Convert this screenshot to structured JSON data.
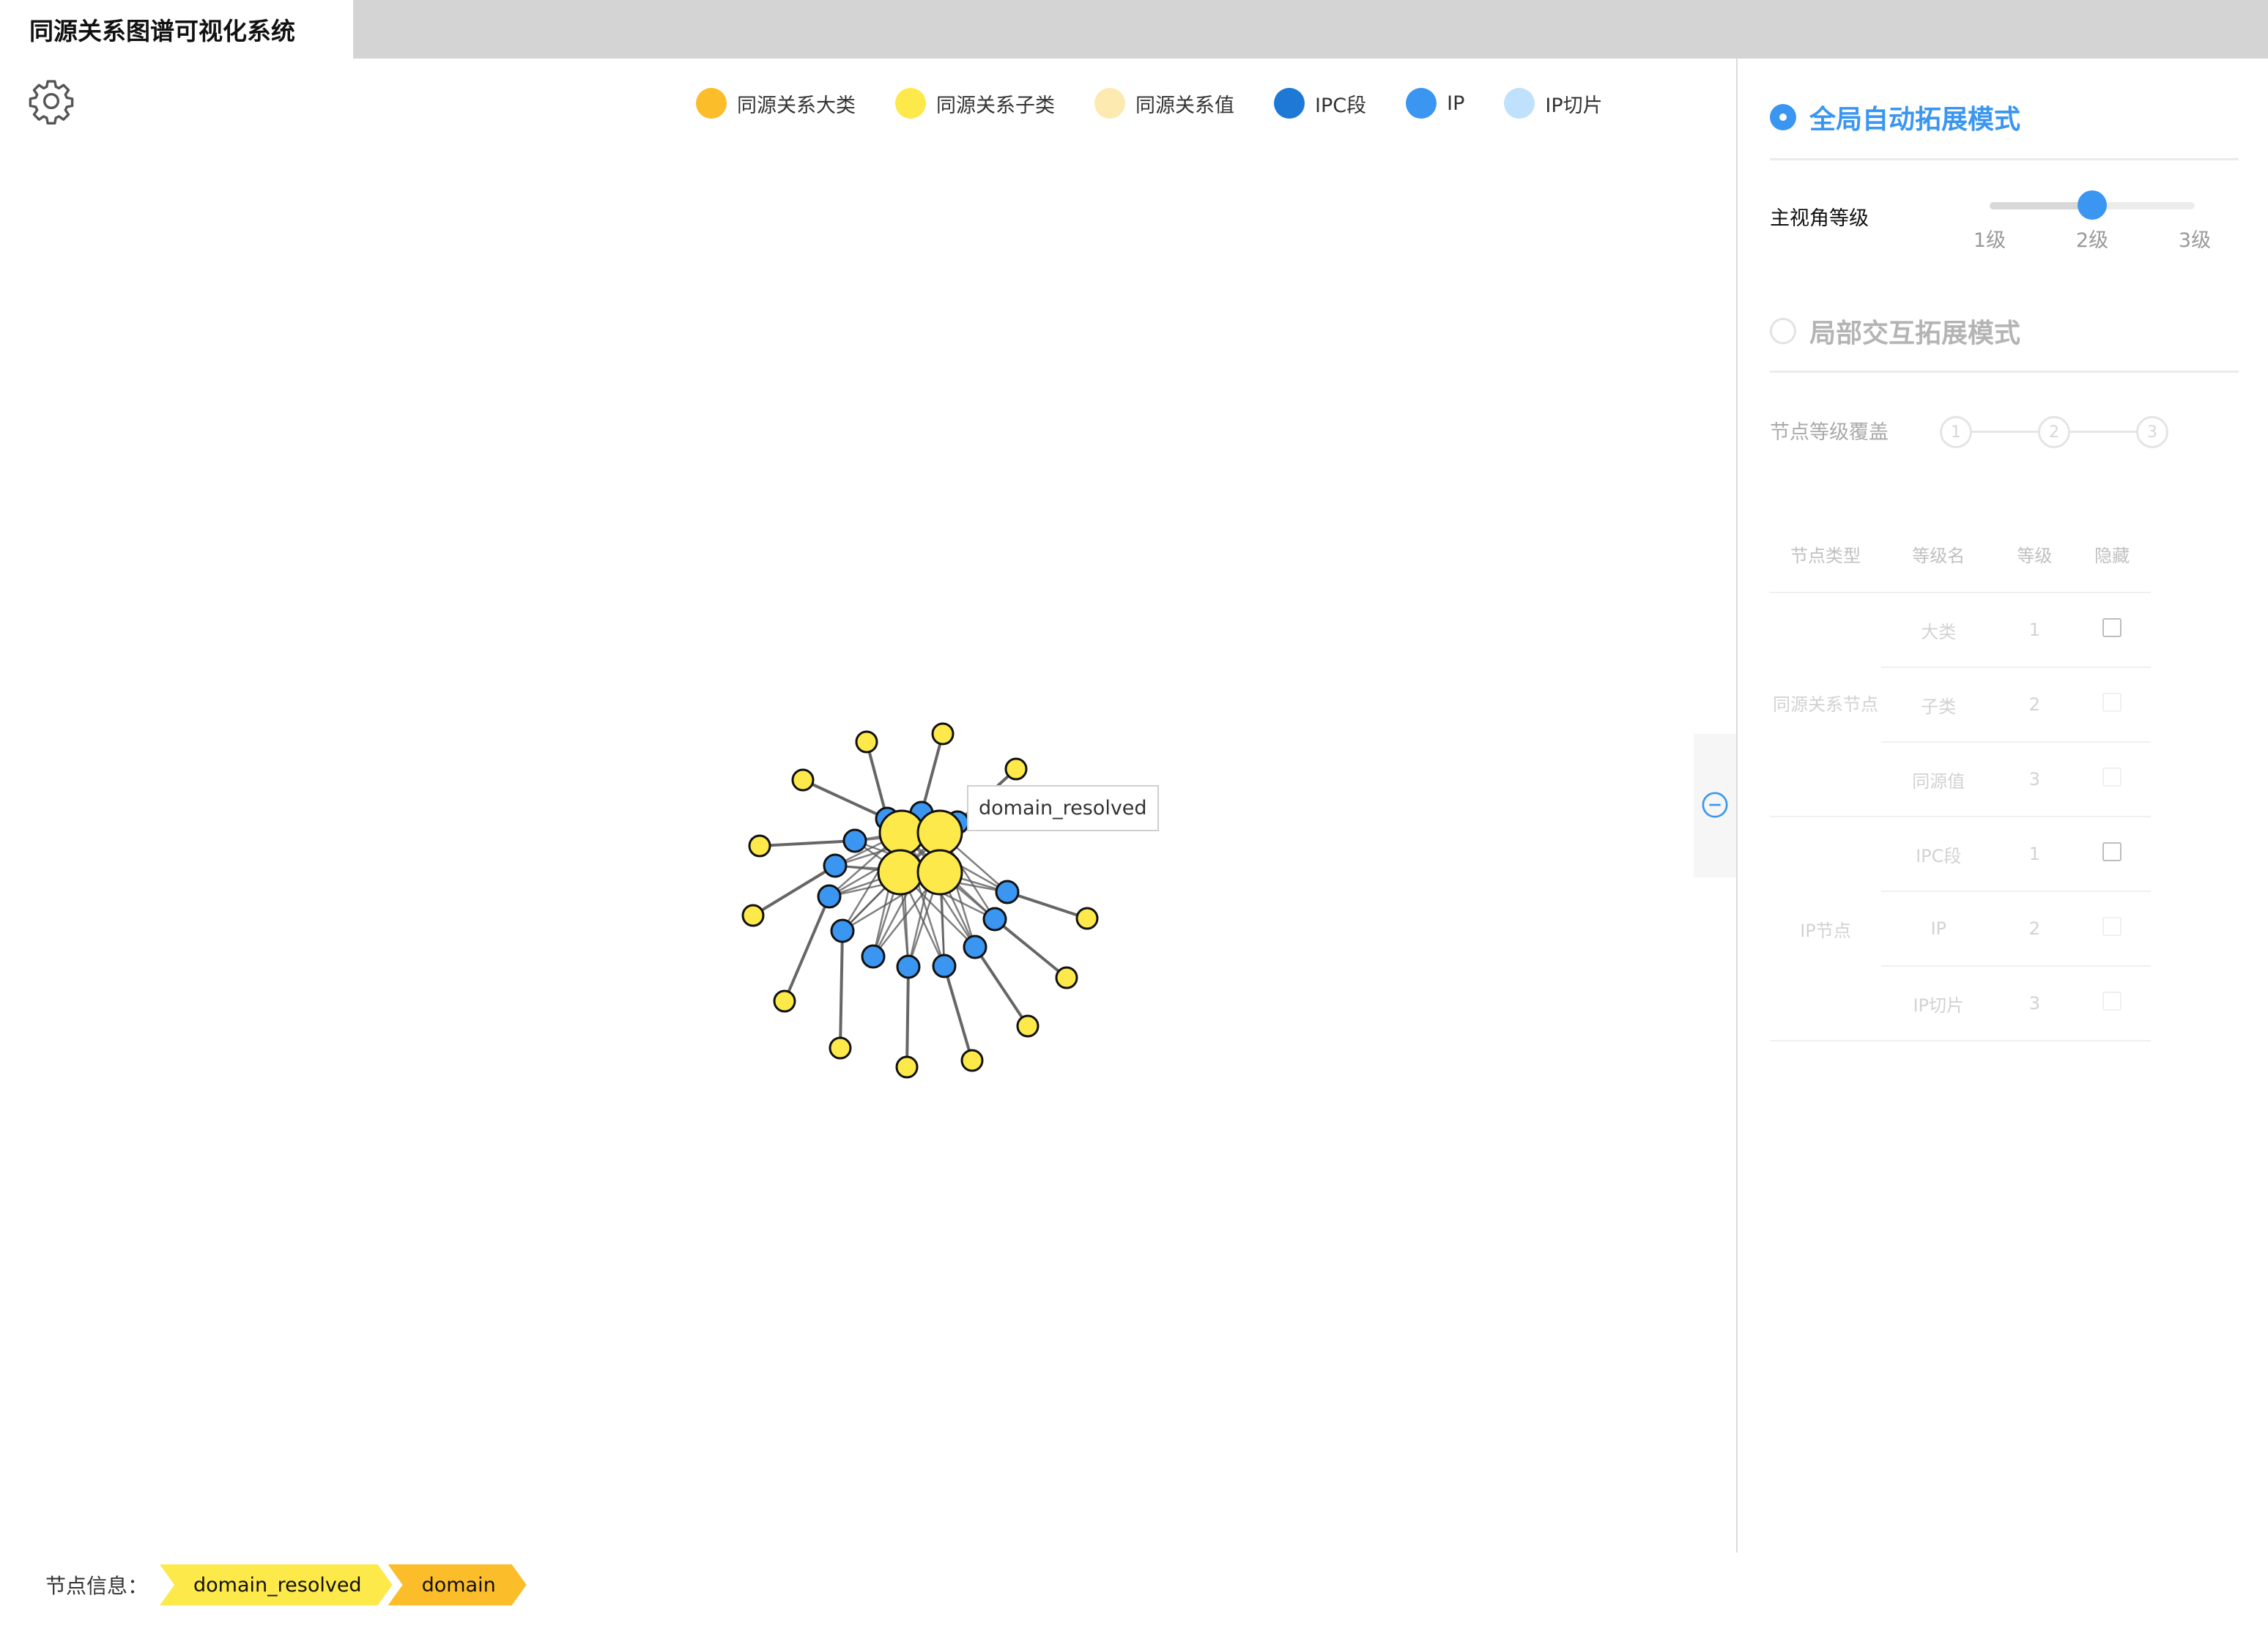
{
  "app": {
    "title": "同源关系图谱可视化系统"
  },
  "legend": [
    {
      "label": "同源关系大类",
      "color": "#fbbd2a"
    },
    {
      "label": "同源关系子类",
      "color": "#fde94a"
    },
    {
      "label": "同源关系值",
      "color": "#fdeab0"
    },
    {
      "label": "IPC段",
      "color": "#1e78d6"
    },
    {
      "label": "IP",
      "color": "#3a96f0"
    },
    {
      "label": "IP切片",
      "color": "#bfe1fb"
    }
  ],
  "graph": {
    "tooltip": "domain_resolved",
    "edge_color": "#555555",
    "stroke_color": "#111111"
  },
  "panel": {
    "global_mode_label": "全局自动拓展模式",
    "global_mode_selected": true,
    "main_level_label": "主视角等级",
    "slider": {
      "marks": [
        "1级",
        "2级",
        "3级"
      ],
      "value_index": 1
    },
    "local_mode_label": "局部交互拓展模式",
    "local_mode_selected": false,
    "coverage_label": "节点等级覆盖",
    "steps": [
      "1",
      "2",
      "3"
    ],
    "table": {
      "headers": [
        "节点类型",
        "等级名",
        "等级",
        "隐藏"
      ],
      "groups": [
        {
          "type": "同源关系节点",
          "rows": [
            {
              "name": "大类",
              "level": "1",
              "checkbox_enabled": true
            },
            {
              "name": "子类",
              "level": "2",
              "checkbox_enabled": false
            },
            {
              "name": "同源值",
              "level": "3",
              "checkbox_enabled": false
            }
          ]
        },
        {
          "type": "IP节点",
          "rows": [
            {
              "name": "IPC段",
              "level": "1",
              "checkbox_enabled": true
            },
            {
              "name": "IP",
              "level": "2",
              "checkbox_enabled": false
            },
            {
              "name": "IP切片",
              "level": "3",
              "checkbox_enabled": false
            }
          ]
        }
      ]
    }
  },
  "node_info": {
    "label": "节点信息：",
    "chips": [
      {
        "text": "domain_resolved",
        "color": "#fde94a"
      },
      {
        "text": "domain",
        "color": "#fbbd2a"
      }
    ]
  }
}
